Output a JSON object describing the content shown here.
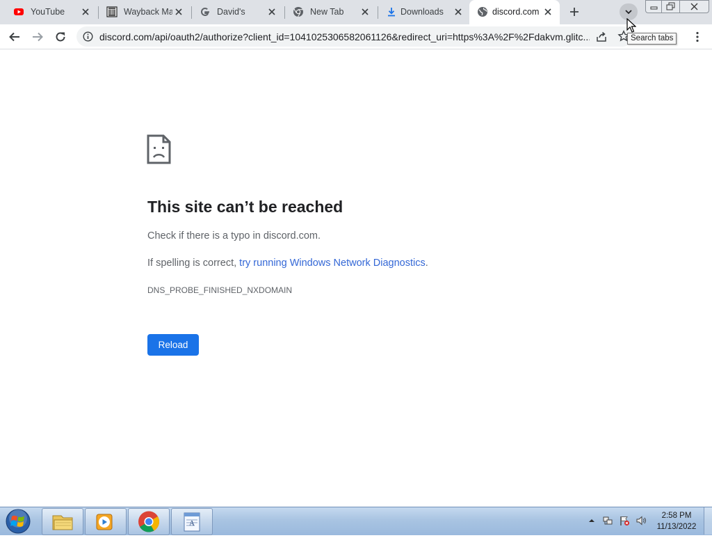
{
  "tabs": [
    {
      "title": "YouTube",
      "icon": "youtube-icon"
    },
    {
      "title": "Wayback Ma",
      "icon": "wayback-machine-icon"
    },
    {
      "title": "David's",
      "icon": "google-icon"
    },
    {
      "title": "New Tab",
      "icon": "chrome-icon"
    },
    {
      "title": "Downloads",
      "icon": "download-icon"
    },
    {
      "title": "discord.com",
      "icon": "globe-icon",
      "active": true
    }
  ],
  "tooltip": "Search tabs",
  "omnibox": {
    "url": "discord.com/api/oauth2/authorize?client_id=1041025306582061126&redirect_uri=https%3A%2F%2Fdakvm.glitc..."
  },
  "error": {
    "title": "This site can’t be reached",
    "line1": "Check if there is a typo in discord.com.",
    "line2_prefix": "If spelling is correct, ",
    "line2_link": "try running Windows Network Diagnostics",
    "line2_suffix": ".",
    "code": "DNS_PROBE_FINISHED_NXDOMAIN",
    "reload_label": "Reload"
  },
  "taskbar": {
    "apps": [
      "file-explorer-icon",
      "media-player-icon",
      "chrome-icon",
      "notepad-icon"
    ],
    "clock_time": "2:58 PM",
    "clock_date": "11/13/2022"
  },
  "colors": {
    "tabstrip_bg": "#dee1e6",
    "link": "#3367d6",
    "button": "#1a73e8"
  }
}
